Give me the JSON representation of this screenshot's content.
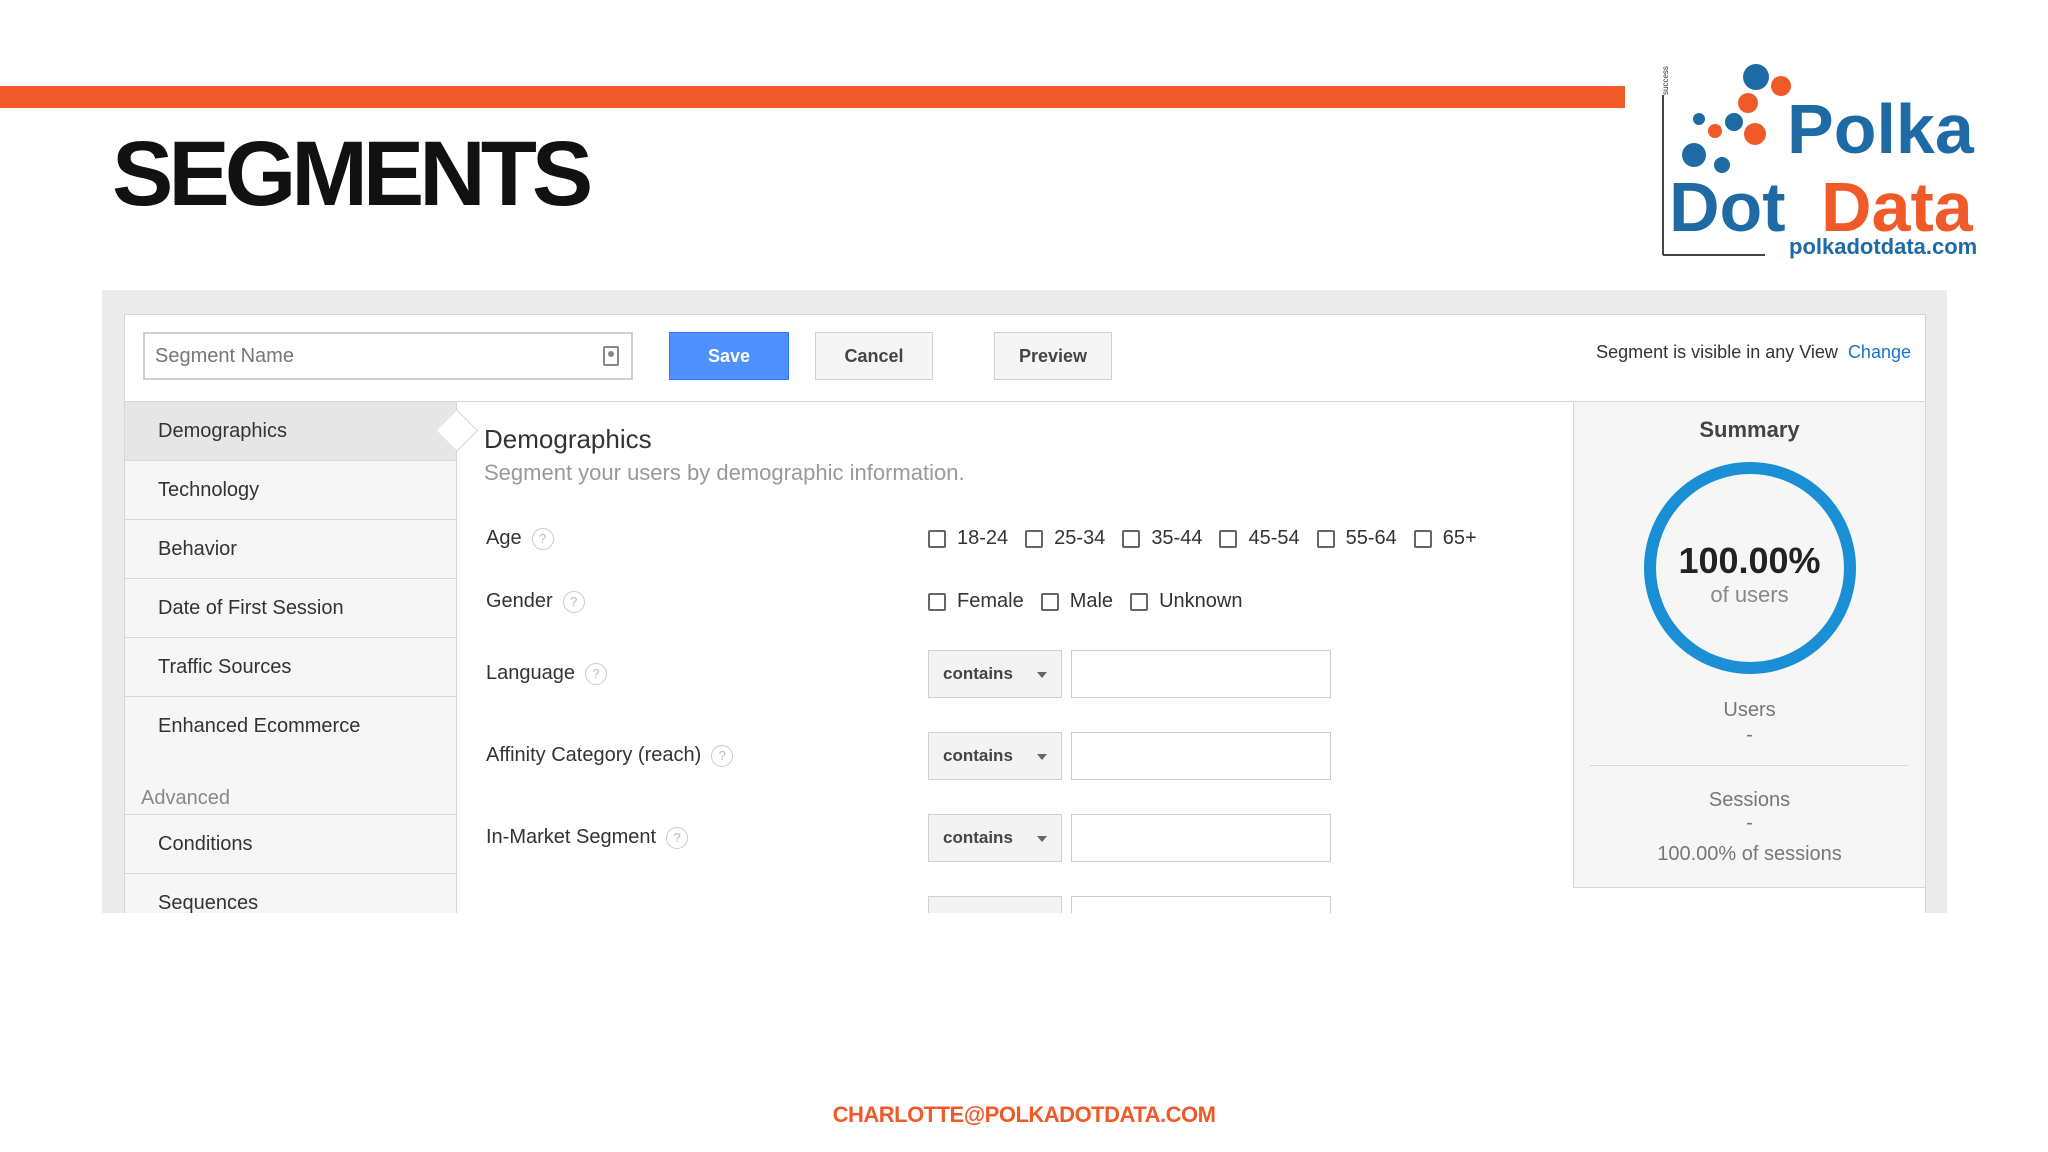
{
  "slide": {
    "title": "SEGMENTS",
    "footer_email": "CHARLOTTE@POLKADOTDATA.COM",
    "accent_color": "#f05a28"
  },
  "logo": {
    "line1": "Polka",
    "line2_dot": "Dot",
    "line2_data": "Data",
    "url": "polkadotdata.com",
    "side_text": "success",
    "colors": {
      "blue": "#1d6aa5",
      "orange": "#f05a28"
    }
  },
  "toolbar": {
    "segment_name_placeholder": "Segment Name",
    "save_label": "Save",
    "cancel_label": "Cancel",
    "preview_label": "Preview",
    "visibility_text": "Segment is visible in any View",
    "change_link": "Change"
  },
  "sidebar": {
    "items": [
      {
        "label": "Demographics",
        "active": true
      },
      {
        "label": "Technology"
      },
      {
        "label": "Behavior"
      },
      {
        "label": "Date of First Session"
      },
      {
        "label": "Traffic Sources"
      },
      {
        "label": "Enhanced Ecommerce"
      }
    ],
    "advanced_heading": "Advanced",
    "advanced_items": [
      {
        "label": "Conditions"
      },
      {
        "label": "Sequences"
      }
    ]
  },
  "main": {
    "title": "Demographics",
    "subtitle": "Segment your users by demographic information.",
    "help_glyph": "?",
    "age": {
      "label": "Age",
      "options": [
        "18-24",
        "25-34",
        "35-44",
        "45-54",
        "55-64",
        "65+"
      ]
    },
    "gender": {
      "label": "Gender",
      "options": [
        "Female",
        "Male",
        "Unknown"
      ]
    },
    "language": {
      "label": "Language",
      "operator": "contains"
    },
    "affinity": {
      "label": "Affinity Category (reach)",
      "operator": "contains"
    },
    "in_market": {
      "label": "In-Market Segment",
      "operator": "contains"
    }
  },
  "summary": {
    "title": "Summary",
    "percent": "100.00%",
    "percent_sub": "of users",
    "users_label": "Users",
    "users_value": "-",
    "sessions_label": "Sessions",
    "sessions_value": "-",
    "sessions_pct": "100.00% of sessions",
    "ring_color": "#1a8fd6"
  }
}
